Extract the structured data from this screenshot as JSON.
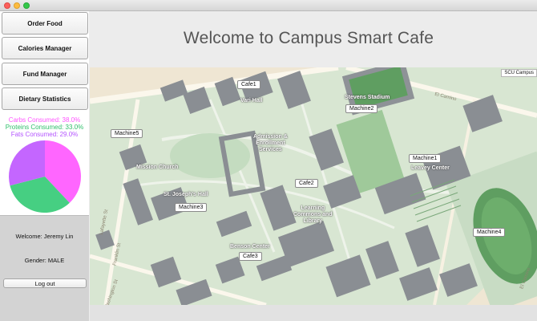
{
  "sidebar": {
    "nav": [
      {
        "label": "Order Food"
      },
      {
        "label": "Calories Manager"
      },
      {
        "label": "Fund Manager"
      },
      {
        "label": "Dietary Statistics"
      }
    ],
    "stats": {
      "carbs": "Carbs Consumed: 38.0%",
      "proteins": "Proteins Consumed: 33.0%",
      "fats": "Fats Consumed: 29.0%"
    },
    "pie_colors": {
      "carbs": "#ff66ff",
      "proteins": "#46cf82",
      "fats": "#c466ff"
    },
    "user": {
      "welcome": "Welcome: Jeremy Lin",
      "gender": "Gender: MALE",
      "logout_label": "Log out"
    }
  },
  "chart_data": {
    "type": "pie",
    "slices": [
      {
        "name": "Carbs",
        "value": 38.0,
        "color": "#ff66ff"
      },
      {
        "name": "Proteins",
        "value": 33.0,
        "color": "#46cf82"
      },
      {
        "name": "Fats",
        "value": 29.0,
        "color": "#c466ff"
      }
    ]
  },
  "main": {
    "title": "Welcome to Campus Smart Cafe",
    "map": {
      "tag": "SCU Campus",
      "markers": {
        "cafe1": "Cafe1",
        "cafe2": "Cafe2",
        "cafe3": "Cafe3",
        "machine1": "Machine1",
        "machine2": "Machine2",
        "machine3": "Machine3",
        "machine4": "Machine4",
        "machine5": "Machine5"
      },
      "labels": {
        "vari_hall": "Vari Hall",
        "stevens": "Stevens Stadium",
        "admission": "Admission &\nEnrollment\nServices",
        "mission_church": "Mission Church",
        "st_josephs": "St. Joseph's Hall",
        "leavey": "Leavey Center",
        "learning_commons": "Learning\nCommons and\nLibrary",
        "benson": "Benson Center"
      },
      "streets": {
        "el_camino": "El Camino",
        "lafayette": "Lafayette St",
        "franklin": "Franklin St",
        "washington": "Washington St",
        "el_camino_right": "El Camino"
      }
    }
  }
}
